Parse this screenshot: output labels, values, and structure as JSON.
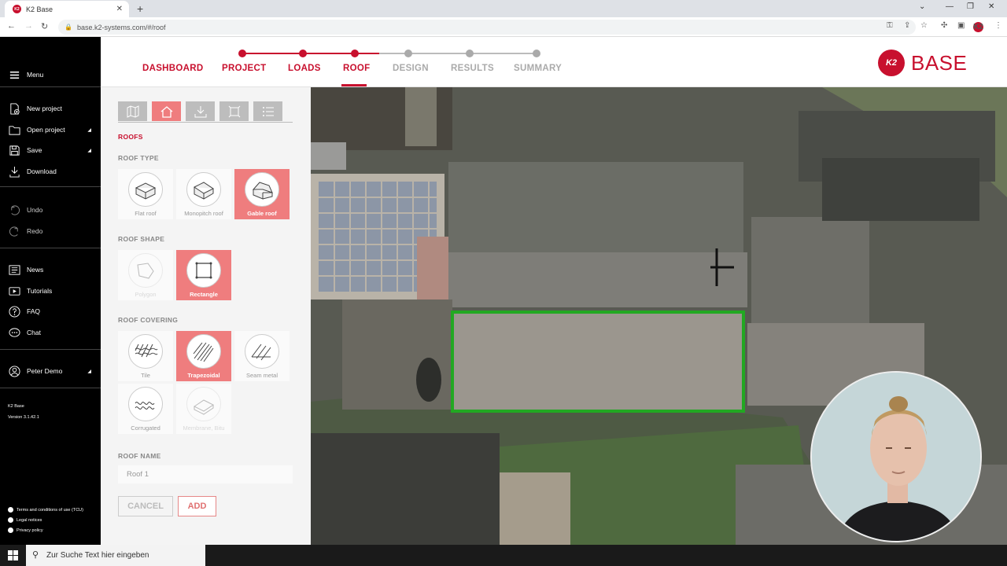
{
  "browser": {
    "tab_title": "K2 Base",
    "tab_close": "✕",
    "new_tab": "+",
    "url": "base.k2-systems.com/#/roof"
  },
  "sidebar": {
    "menu_label": "Menu",
    "file_items": [
      {
        "label": "New project",
        "icon": "new-file-icon"
      },
      {
        "label": "Open project",
        "icon": "folder-icon"
      },
      {
        "label": "Save",
        "icon": "save-icon"
      },
      {
        "label": "Download",
        "icon": "download-icon"
      }
    ],
    "edit_items": [
      {
        "label": "Undo",
        "icon": "undo-icon"
      },
      {
        "label": "Redo",
        "icon": "redo-icon"
      }
    ],
    "help_items": [
      {
        "label": "News",
        "icon": "news-icon"
      },
      {
        "label": "Tutorials",
        "icon": "video-icon"
      },
      {
        "label": "FAQ",
        "icon": "question-icon"
      },
      {
        "label": "Chat",
        "icon": "chat-icon"
      }
    ],
    "user": "Peter Demo",
    "app_name": "K2 Base",
    "version": "Version 3.1.42.1",
    "legal": [
      "Terms and conditions of use (TCU)",
      "Legal notices",
      "Privacy policy"
    ]
  },
  "steps": [
    {
      "label": "DASHBOARD",
      "state": "link"
    },
    {
      "label": "PROJECT",
      "state": "done"
    },
    {
      "label": "LOADS",
      "state": "done"
    },
    {
      "label": "ROOF",
      "state": "active"
    },
    {
      "label": "DESIGN",
      "state": "todo"
    },
    {
      "label": "RESULTS",
      "state": "todo"
    },
    {
      "label": "SUMMARY",
      "state": "todo"
    }
  ],
  "logo": {
    "badge": "K2",
    "text": "BASE"
  },
  "panel": {
    "heading": "ROOFS",
    "roof_type_label": "ROOF TYPE",
    "roof_types": [
      {
        "label": "Flat roof",
        "selected": false
      },
      {
        "label": "Monopitch roof",
        "selected": false
      },
      {
        "label": "Gable roof",
        "selected": true
      }
    ],
    "roof_shape_label": "ROOF SHAPE",
    "roof_shapes": [
      {
        "label": "Polygon",
        "selected": false,
        "disabled": true
      },
      {
        "label": "Rectangle",
        "selected": true
      }
    ],
    "roof_covering_label": "ROOF COVERING",
    "roof_coverings": [
      {
        "label": "Tile",
        "selected": false
      },
      {
        "label": "Trapezoidal",
        "selected": true
      },
      {
        "label": "Seam metal",
        "selected": false
      },
      {
        "label": "Corrugated",
        "selected": false
      },
      {
        "label": "Membrane, Bitu",
        "selected": false,
        "disabled": true
      }
    ],
    "roof_name_label": "ROOF NAME",
    "roof_name_value": "Roof 1",
    "cancel_label": "CANCEL",
    "add_label": "ADD"
  },
  "taskbar": {
    "search_placeholder": "Zur Suche Text hier eingeben"
  },
  "colors": {
    "brand_red": "#c8102e",
    "selected_bg": "#ef7d7e",
    "inactive_step": "#aaaaaa",
    "roof_outline": "#22a822"
  }
}
